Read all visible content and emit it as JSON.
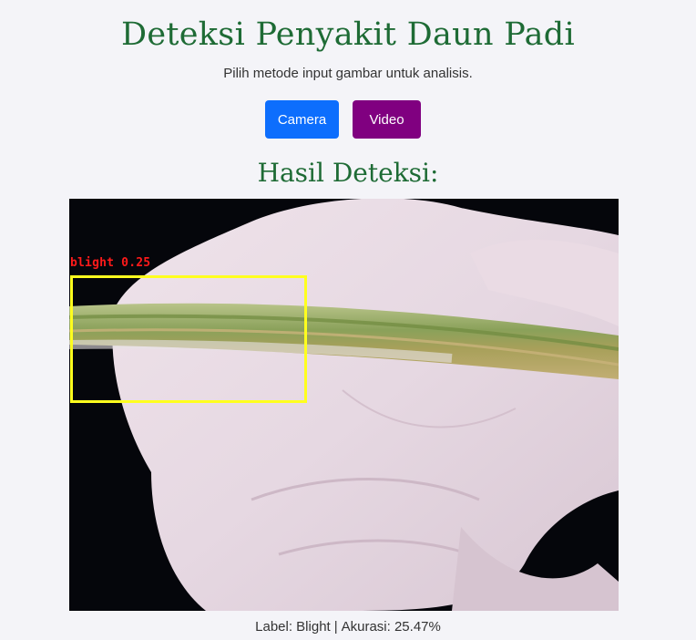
{
  "header": {
    "title": "Deteksi Penyakit Daun Padi",
    "subtitle": "Pilih metode input gambar untuk analisis."
  },
  "buttons": {
    "camera_label": "Camera",
    "video_label": "Video",
    "camera_color": "#0d6efd",
    "video_color": "#800080"
  },
  "result": {
    "heading": "Hasil Deteksi:",
    "detection_label": "blight 0.25",
    "label_text": "Label: Blight",
    "separator": "|",
    "accuracy_text": "Akurasi: 25.47%"
  },
  "colors": {
    "title_green": "#1e6b35",
    "box_yellow": "#ffff1e",
    "label_red": "#ff1a1a"
  }
}
